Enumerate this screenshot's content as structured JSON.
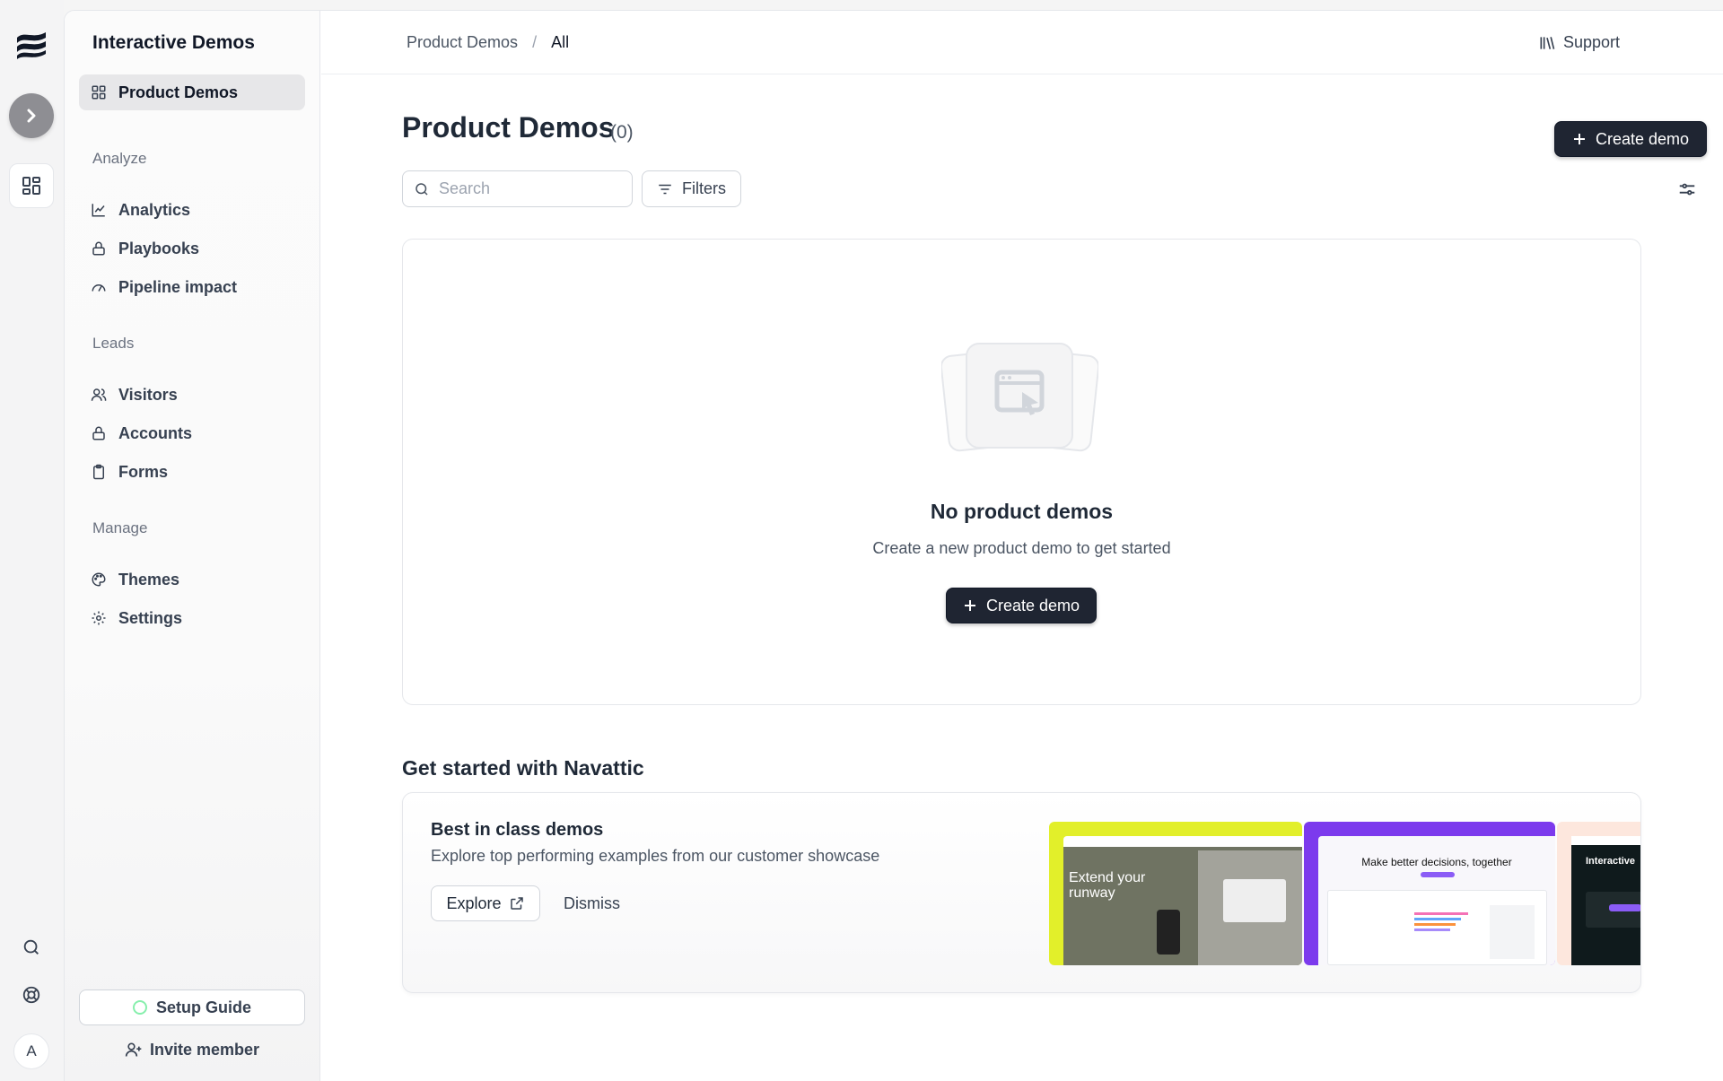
{
  "rail": {
    "avatar_initial": "A"
  },
  "sidebar": {
    "workspace_title": "Interactive Demos",
    "primary_item": "Product Demos",
    "sections": [
      {
        "label": "Analyze",
        "items": [
          "Analytics",
          "Playbooks",
          "Pipeline impact"
        ]
      },
      {
        "label": "Leads",
        "items": [
          "Visitors",
          "Accounts",
          "Forms"
        ]
      },
      {
        "label": "Manage",
        "items": [
          "Themes",
          "Settings"
        ]
      }
    ],
    "setup_guide": "Setup Guide",
    "invite_member": "Invite member"
  },
  "topbar": {
    "breadcrumb": [
      "Product Demos",
      "All"
    ],
    "separator": "/",
    "support": "Support"
  },
  "main": {
    "title": "Product Demos",
    "count": "(0)",
    "create_button": "Create demo",
    "search_placeholder": "Search",
    "filters_label": "Filters",
    "empty": {
      "title": "No product demos",
      "subtitle": "Create a new product demo to get started",
      "button": "Create demo"
    },
    "get_started": {
      "heading": "Get started with Navattic",
      "card_title": "Best in class demos",
      "card_text": "Explore top performing examples from our customer showcase",
      "explore": "Explore",
      "dismiss": "Dismiss",
      "thumbnails": [
        {
          "headline": "Extend your runway",
          "accent": "#e2ef2a"
        },
        {
          "headline": "Make better decisions, together",
          "accent": "#7c3aed"
        },
        {
          "headline": "Interactive",
          "accent": "#fde7dd"
        }
      ]
    }
  },
  "colors": {
    "primary_dark": "#1f2532",
    "active_nav": "#e7e7e9",
    "setup_ring": "#86efac"
  }
}
